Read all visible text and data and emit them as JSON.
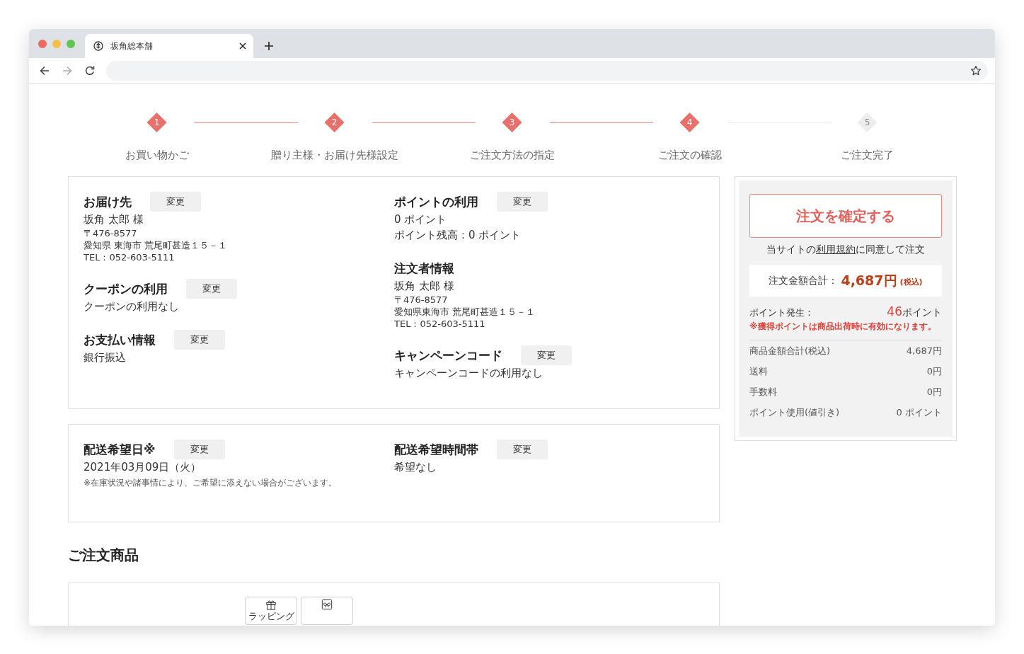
{
  "browser": {
    "tab": {
      "title": "坂角総本舗"
    }
  },
  "steps": [
    {
      "number": "1",
      "label": "お買い物かご",
      "reached": true
    },
    {
      "number": "2",
      "label": "贈り主様・お届け先様設定",
      "reached": true
    },
    {
      "number": "3",
      "label": "ご注文方法の指定",
      "reached": true
    },
    {
      "number": "4",
      "label": "ご注文の確認",
      "reached": true
    },
    {
      "number": "5",
      "label": "ご注文完了",
      "reached": false
    }
  ],
  "info_card": {
    "columns": [
      {
        "sections": [
          {
            "title": "お届け先",
            "button": "変更",
            "lines": [
              {
                "kind": "text",
                "text": "坂角 太郎 様"
              },
              {
                "kind": "detail",
                "text": "〒476-8577"
              },
              {
                "kind": "detail",
                "text": "愛知県 東海市 荒尾町甚造１５－１"
              },
              {
                "kind": "detail",
                "text": "TEL：052-603-5111"
              }
            ]
          },
          {
            "title": "クーポンの利用",
            "button": "変更",
            "lines": [
              {
                "kind": "text",
                "text": "クーポンの利用なし"
              }
            ]
          },
          {
            "title": "お支払い情報",
            "button": "変更",
            "lines": [
              {
                "kind": "text",
                "text": "銀行振込"
              }
            ]
          }
        ]
      },
      {
        "sections": [
          {
            "title": "ポイントの利用",
            "button": "変更",
            "lines": [
              {
                "kind": "text",
                "text": "0 ポイント"
              },
              {
                "kind": "text",
                "text": "ポイント残高：0 ポイント"
              }
            ]
          },
          {
            "title": "注文者情報",
            "lines": [
              {
                "kind": "text",
                "text": "坂角 太郎 様"
              },
              {
                "kind": "detail",
                "text": "〒476-8577"
              },
              {
                "kind": "detail",
                "text": "愛知県東海市 荒尾町甚造１５－１"
              },
              {
                "kind": "detail",
                "text": "TEL：052-603-5111"
              }
            ]
          },
          {
            "title": "キャンペーンコード",
            "button": "変更",
            "lines": [
              {
                "kind": "text",
                "text": "キャンペーンコードの利用なし"
              }
            ]
          }
        ]
      }
    ]
  },
  "delivery_card": {
    "columns": [
      {
        "sections": [
          {
            "title": "配送希望日※",
            "button": "変更",
            "lines": [
              {
                "kind": "text",
                "text": "2021年03月09日（火）"
              },
              {
                "kind": "note",
                "text": "※在庫状況や諸事情により、ご希望に添えない場合がございます。"
              }
            ]
          }
        ]
      },
      {
        "sections": [
          {
            "title": "配送希望時間帯",
            "button": "変更",
            "lines": [
              {
                "kind": "text",
                "text": "希望なし"
              }
            ]
          }
        ]
      }
    ]
  },
  "order_items": {
    "heading": "ご注文商品",
    "badges": [
      {
        "kind": "gift",
        "label": "ラッピング"
      },
      {
        "kind": "bow"
      }
    ]
  },
  "summary": {
    "confirm_button": "注文を確定する",
    "terms": {
      "before": "当サイトの",
      "link": "利用規約",
      "after": "に同意して注文"
    },
    "total": {
      "label": "注文金額合計：",
      "amount": "4,687円",
      "tax_note": "(税込)"
    },
    "points": {
      "label": "ポイント発生：",
      "value": "46",
      "unit": "ポイント",
      "note": "※獲得ポイントは商品出荷時に有効になります。"
    },
    "rows": [
      {
        "label": "商品金額合計(税込)",
        "value": "4,687円"
      },
      {
        "label": "送料",
        "value": "0円"
      },
      {
        "label": "手数料",
        "value": "0円"
      },
      {
        "label": "ポイント使用(値引き)",
        "value": "0 ポイント"
      }
    ]
  }
}
